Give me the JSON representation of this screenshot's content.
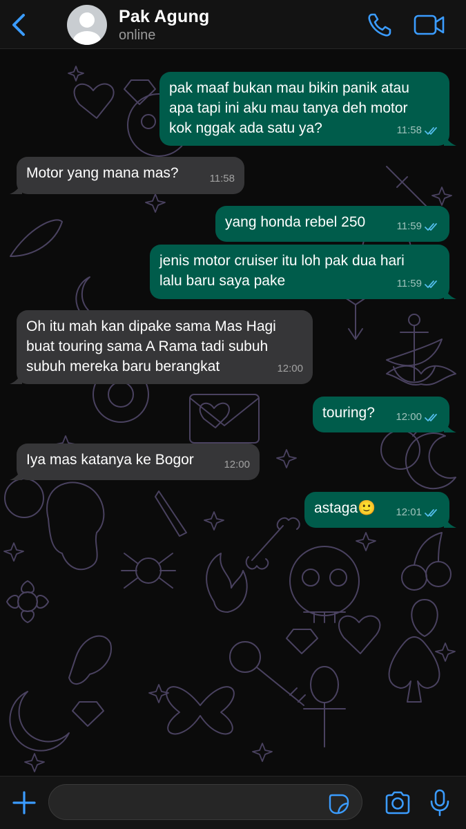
{
  "header": {
    "contact_name": "Pak Agung",
    "status": "online"
  },
  "colors": {
    "accent": "#3b9cff",
    "outgoing_bubble": "#005c4b",
    "incoming_bubble": "#363638",
    "read_ticks": "#53bdeb"
  },
  "icons": [
    "back-chevron",
    "avatar-placeholder",
    "phone",
    "video-camera",
    "plus",
    "sticker",
    "camera",
    "microphone",
    "double-check"
  ],
  "messages": [
    {
      "direction": "out",
      "text": "pak maaf bukan mau bikin panik atau\napa tapi ini aku mau tanya deh motor\nkok nggak ada satu ya?",
      "time": "11:58",
      "read": true
    },
    {
      "direction": "in",
      "text": "Motor yang mana mas?",
      "time": "11:58"
    },
    {
      "direction": "out",
      "text": "yang honda rebel 250",
      "time": "11:59",
      "read": true
    },
    {
      "direction": "out",
      "text": "jenis motor cruiser itu loh pak dua hari\nlalu baru saya pake",
      "time": "11:59",
      "read": true
    },
    {
      "direction": "in",
      "text": "Oh itu mah kan dipake sama Mas Hagi\nbuat touring sama A Rama tadi subuh\nsubuh mereka baru berangkat",
      "time": "12:00"
    },
    {
      "direction": "out",
      "text": "touring?",
      "time": "12:00",
      "read": true
    },
    {
      "direction": "in",
      "text": "Iya mas katanya ke Bogor",
      "time": "12:00"
    },
    {
      "direction": "out",
      "text": "astaga🙂",
      "time": "12:01",
      "read": true
    }
  ],
  "input": {
    "value": "",
    "placeholder": ""
  }
}
